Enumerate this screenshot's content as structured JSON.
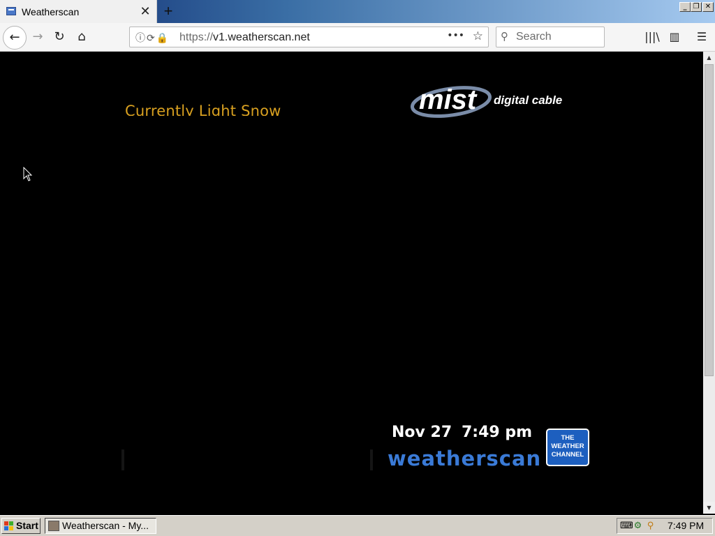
{
  "browser": {
    "tab_title": "Weatherscan",
    "tab_close": "✕",
    "new_tab": "+",
    "url_protocol": "https://",
    "url_host": "v1.weatherscan.net",
    "url_more": "•••",
    "bookmark_star": "☆",
    "search_placeholder": "Search",
    "window_minimize": "_",
    "window_restore": "❐",
    "window_close": "✕",
    "back_glyph": "←",
    "forward_glyph": "→",
    "reload_glyph": "↻",
    "home_glyph": "⌂",
    "library_glyph": "|||\\",
    "sidebar_glyph": "▥",
    "menu_glyph": "☰"
  },
  "weatherscan": {
    "current_conditions": "Currently Light Snow",
    "sponsor_logo": "mist",
    "sponsor_tagline": "digital cable",
    "date": "Nov 27",
    "time": "7:49 pm",
    "brand": "weatherscan",
    "channel_logo_lines": [
      "THE",
      "WEATHER",
      "CHANNEL"
    ]
  },
  "taskbar": {
    "start_label": "Start",
    "task_label": "Weatherscan - My...",
    "clock": "7:49 PM"
  },
  "colors": {
    "conditions_text": "#d8a020",
    "brand_blue": "#3a7ad6",
    "twc_blue": "#1d5fbf"
  }
}
